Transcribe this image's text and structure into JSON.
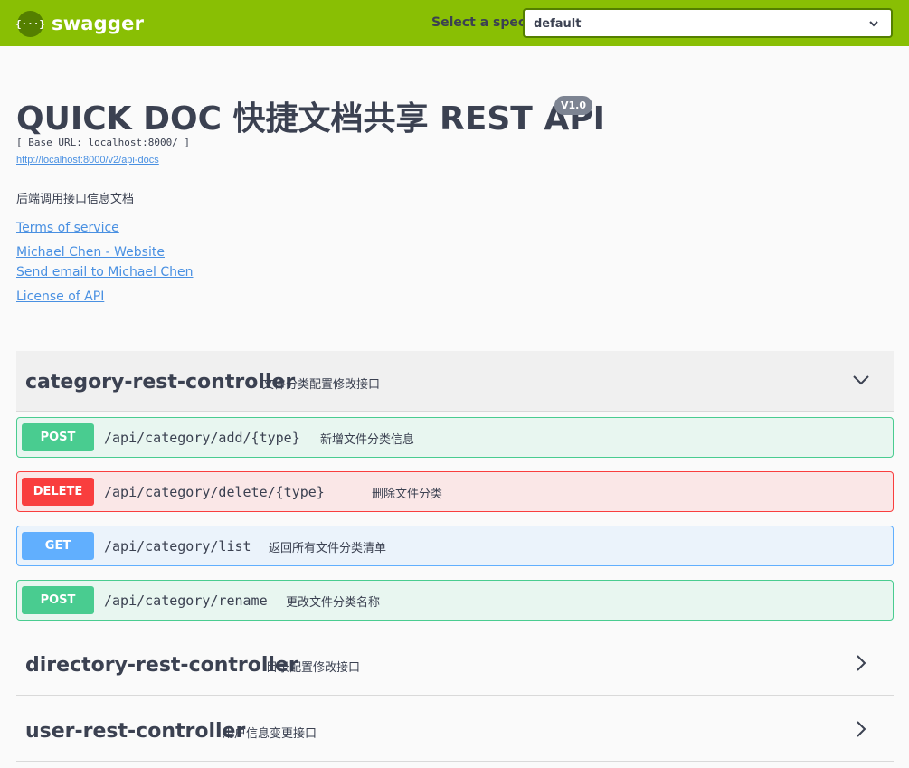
{
  "topbar": {
    "logo_text": "swagger",
    "logo_glyph": "{···}",
    "spec_label": "Select a spec",
    "spec_value": "default"
  },
  "info": {
    "title": "QUICK DOC 快捷文档共享 REST API",
    "version": "V1.0",
    "base_url": "[ Base URL: localhost:8000/ ]",
    "api_docs_url": "http://localhost:8000/v2/api-docs",
    "description": "后端调用接口信息文档",
    "terms": "Terms of service",
    "contact_website": "Michael Chen - Website",
    "contact_email": "Send email to Michael Chen",
    "license": "License of API"
  },
  "tags": [
    {
      "name": "category-rest-controller",
      "description": "文件分类配置修改接口",
      "expanded": true,
      "operations": [
        {
          "method": "POST",
          "path": "/api/category/add/{type}",
          "summary": "新增文件分类信息"
        },
        {
          "method": "DELETE",
          "path": "/api/category/delete/{type}",
          "summary": "删除文件分类"
        },
        {
          "method": "GET",
          "path": "/api/category/list",
          "summary": "返回所有文件分类清单"
        },
        {
          "method": "POST",
          "path": "/api/category/rename",
          "summary": "更改文件分类名称"
        }
      ]
    },
    {
      "name": "directory-rest-controller",
      "description": "目录配置修改接口",
      "expanded": false
    },
    {
      "name": "user-rest-controller",
      "description": "用户信息变更接口",
      "expanded": false
    }
  ],
  "colors": {
    "topbar": "#89bf04",
    "post": "#49cc90",
    "delete": "#f93e3e",
    "get": "#61affe",
    "link": "#4990e2"
  }
}
